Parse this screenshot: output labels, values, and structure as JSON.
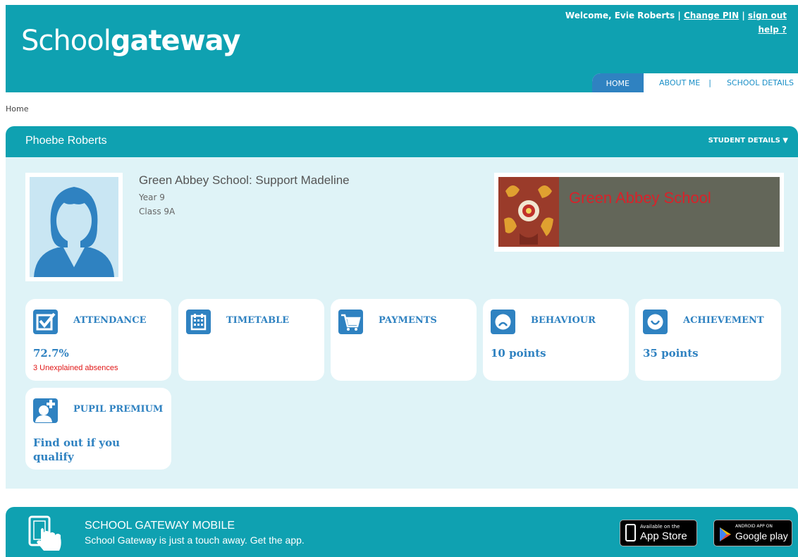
{
  "header": {
    "logo_part1": "Scho",
    "logo_part2": "ol",
    "logo_part3": "gateway",
    "welcome": "Welcome, Evie Roberts |",
    "change_pin": "Change PIN",
    "sep": "|",
    "sign_out": "sign out",
    "help": "help ?",
    "nav": {
      "home": "HOME",
      "about": "ABOUT ME",
      "sep": "|",
      "school": "SCHOOL DETAILS"
    }
  },
  "breadcrumb": "Home",
  "student": {
    "name": "Phoebe Roberts",
    "details_label": "STUDENT DETAILS ▼",
    "school_title": "Green Abbey School: Support Madeline",
    "year": "Year 9",
    "class": "Class 9A",
    "banner_text": "Green Abbey School"
  },
  "tiles": {
    "attendance": {
      "label": "ATTENDANCE",
      "value": "72.7%",
      "note": "3 Unexplained absences"
    },
    "timetable": {
      "label": "TIMETABLE"
    },
    "payments": {
      "label": "PAYMENTS"
    },
    "behaviour": {
      "label": "BEHAVIOUR",
      "value": "10 points"
    },
    "achievement": {
      "label": "ACHIEVEMENT",
      "value": "35 points"
    },
    "pupil_premium": {
      "label": "PUPIL PREMIUM",
      "value": "Find out if you qualify"
    }
  },
  "footer": {
    "title": "SCHOOL GATEWAY MOBILE",
    "subtitle": "School Gateway is just a touch away. Get the app.",
    "appstore_small": "Available on the",
    "appstore_big": "App Store",
    "gplay_small": "ANDROID APP ON",
    "gplay_big": "Google play"
  },
  "colors": {
    "teal": "#0fa1b1",
    "blue": "#2f82c1",
    "panel": "#dff3f7",
    "alert": "#e01616"
  }
}
